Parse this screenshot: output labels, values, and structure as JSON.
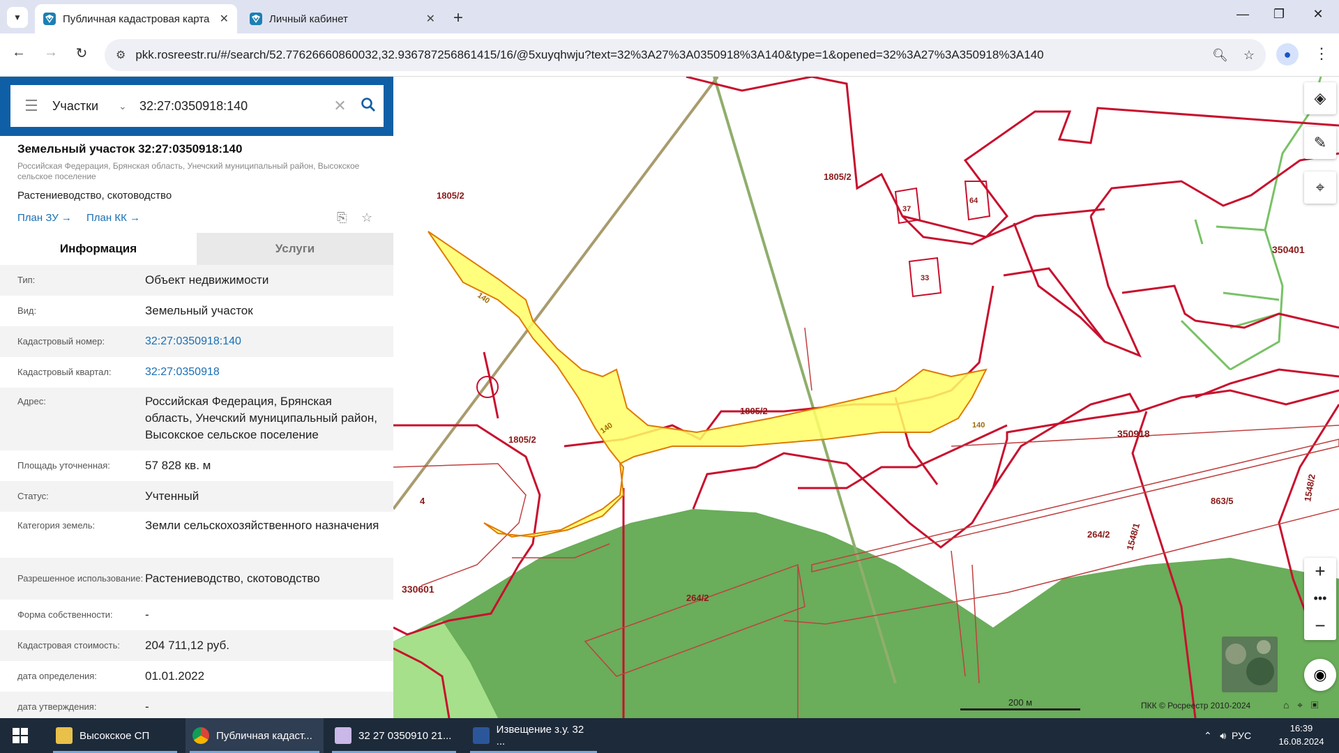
{
  "browser": {
    "tabs": [
      {
        "title": "Публичная кадастровая карта",
        "active": true
      },
      {
        "title": "Личный кабинет",
        "active": false
      }
    ],
    "new_tab": "+",
    "url": "pkk.rosreestr.ru/#/search/52.77626660860032,32.936787256861415/16/@5xuyqhwju?text=32%3A27%3A0350918%3A140&type=1&opened=32%3A27%3A350918%3A140",
    "window_controls": {
      "minimize": "—",
      "restore": "❐",
      "close": "✕"
    }
  },
  "search": {
    "kind": "Участки",
    "query": "32:27:0350918:140"
  },
  "object": {
    "title": "Земельный участок 32:27:0350918:140",
    "address": "Российская Федерация, Брянская область, Унечский муниципальный район, Высокское сельское поселение",
    "usage": "Растениеводство, скотоводство",
    "link_zu": "План ЗУ →",
    "link_kk": "План КК →"
  },
  "tabs": {
    "info": "Информация",
    "services": "Услуги"
  },
  "attributes": [
    {
      "key": "Тип:",
      "value": "Объект недвижимости"
    },
    {
      "key": "Вид:",
      "value": "Земельный участок"
    },
    {
      "key": "Кадастровый номер:",
      "value": "32:27:0350918:140"
    },
    {
      "key": "Кадастровый квартал:",
      "value": "32:27:0350918"
    },
    {
      "key": "Адрес:",
      "value": "Российская Федерация, Брянская область, Унечский муниципальный район, Высокское сельское поселение"
    },
    {
      "key": "Площадь уточненная:",
      "value": "57 828 кв. м"
    },
    {
      "key": "Статус:",
      "value": "Учтенный"
    },
    {
      "key": "Категория земель:",
      "value": "Земли сельскохозяйственного назначения"
    },
    {
      "key": "Разрешенное использование:",
      "value": "Растениеводство, скотоводство"
    },
    {
      "key": "Форма собственности:",
      "value": "-"
    },
    {
      "key": "Кадастровая стоимость:",
      "value": "204 711,12 руб."
    },
    {
      "key": "дата определения:",
      "value": "01.01.2022"
    },
    {
      "key": "дата утверждения:",
      "value": "-"
    }
  ],
  "map": {
    "labels": [
      "1805/2",
      "1805/2",
      "1805/2",
      "1805/2",
      "64",
      "37",
      "33",
      "350401",
      "140",
      "140",
      "140",
      "350918",
      "4",
      "330601",
      "264/2",
      "264/2",
      "863/5",
      "1548/1",
      "1548/2"
    ],
    "scale": "200 м",
    "copyright": "ПКК © Росреестр 2010-2024"
  },
  "taskbar": {
    "items": [
      {
        "label": "Высокское СП"
      },
      {
        "label": "Публичная кадаст..."
      },
      {
        "label": "32  27  0350910  21..."
      },
      {
        "label": "Извещение з.у. 32 ..."
      }
    ],
    "lang": "РУС",
    "time": "16:39",
    "date": "16.08.2024"
  },
  "colors": {
    "brand_blue": "#0f5fa6",
    "parcel_red": "#c8102e",
    "selected_fill": "#ffff66",
    "forest": "#6aad5a"
  }
}
